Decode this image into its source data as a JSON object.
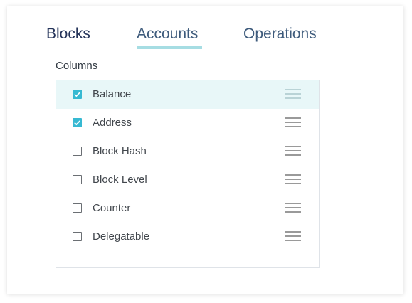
{
  "tabs": [
    {
      "label": "Blocks"
    },
    {
      "label": "Accounts"
    },
    {
      "label": "Operations"
    }
  ],
  "active_tab": "Accounts",
  "columns_section": {
    "label": "Columns",
    "items": [
      {
        "label": "Balance",
        "checked": true,
        "highlighted": true
      },
      {
        "label": "Address",
        "checked": true,
        "highlighted": false
      },
      {
        "label": "Block Hash",
        "checked": false,
        "highlighted": false
      },
      {
        "label": "Block Level",
        "checked": false,
        "highlighted": false
      },
      {
        "label": "Counter",
        "checked": false,
        "highlighted": false
      },
      {
        "label": "Delegatable",
        "checked": false,
        "highlighted": false
      }
    ]
  },
  "icons": {
    "checkbox_checked": "check-icon",
    "drag_handle": "drag-handle-icon"
  },
  "colors": {
    "accent": "#37b9d2",
    "tab_underline": "#a6dde3",
    "highlight_row": "#e8f7f8"
  }
}
